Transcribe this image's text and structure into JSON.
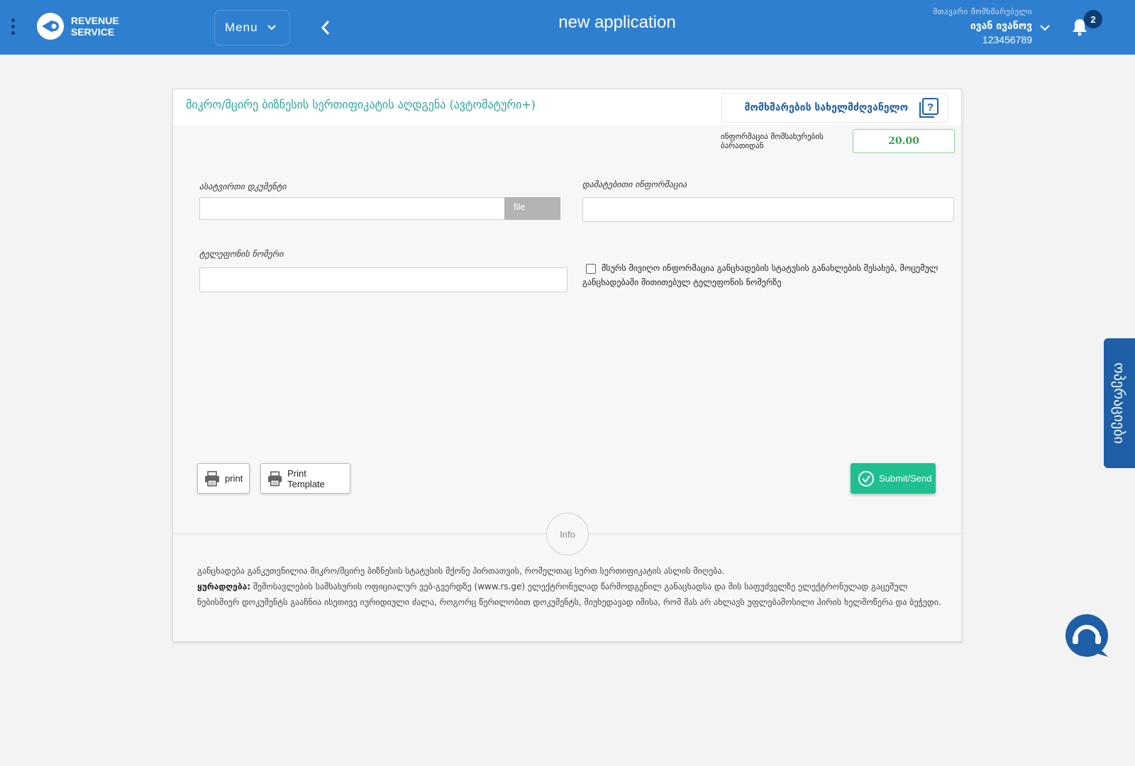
{
  "header": {
    "logo_line1": "REVENUE",
    "logo_line2": "SERVICE",
    "menu_label": "Menu",
    "page_title": "new application",
    "user_role": "მთავარი მომხმარებელი",
    "user_name": "ივან ივანოვ",
    "user_id": "123456789",
    "notification_count": "2"
  },
  "form": {
    "title": "მიკრო/მცირე ბიზნესის სერთიფიკატის აღდგენა (ავტომატური+)",
    "guide_label": "მომხმარების სახელმძღვანელო",
    "fee_label": "ინფორმაცია მომსახურების ბარათიდან",
    "fee_value": "20.00",
    "upload_label": "ასატვირთი დკუმენტი",
    "file_button": "file",
    "additional_label": "დამატებითი ინფორმაცია",
    "phone_label": "ტელეფონის ნომერი",
    "checkbox_text": "მსურს მივიღო ინფორმაცია განცხადების სტატუსის განახლების შესახებ, მოცემულ განცხადებაში მითითებულ ტელეფონის ნომერზე",
    "print_label": "print",
    "print_template_label": "Print Template",
    "submit_label": "Submit/Send",
    "info_label": "Info",
    "info_text_1": "განცხადება განკუთვნილია მიკრო/მცირე ბიზნესის სტატუსის მქონე პირთათვის, რომელთაც სურთ სერთიფიკატის ასლის მიღება.",
    "info_warning_label": "ყურადღება:",
    "info_text_2": " შემოსავლების სამსახურის ოფიციალურ ვებ-გვერდზე (www.rs.ge) ელექტრონულად წარმოდგენილ განაცხადსა და მის საფუძველზე ელექტრონულად გაცემულ ნებისმიერ დოკუმენტს გააჩნია ისეთივე იურიდიული ძალა, როგორც წერილობით დოკუმენტს, მიუხედავად იმისა, რომ მას არ ახლავს უფლებამოსილი პირის ხელმოწერა და ბეჭედი."
  },
  "side_tab_label": "ოპერაციები",
  "icons": {
    "kebab": "kebab-menu-icon",
    "logo": "revenue-service-logo",
    "menu_chevron": "chevron-down-icon",
    "back": "chevron-left-icon",
    "user_chevron": "chevron-down-icon",
    "bell": "bell-icon",
    "guide": "help-book-icon",
    "print": "printer-icon",
    "submit": "check-circle-icon",
    "chat": "support-chat-icon"
  },
  "colors": {
    "header_bg": "#2f7fd0",
    "title_green": "#29a893",
    "submit_green": "#1fbf91",
    "accent_blue": "#1f5fa8"
  }
}
